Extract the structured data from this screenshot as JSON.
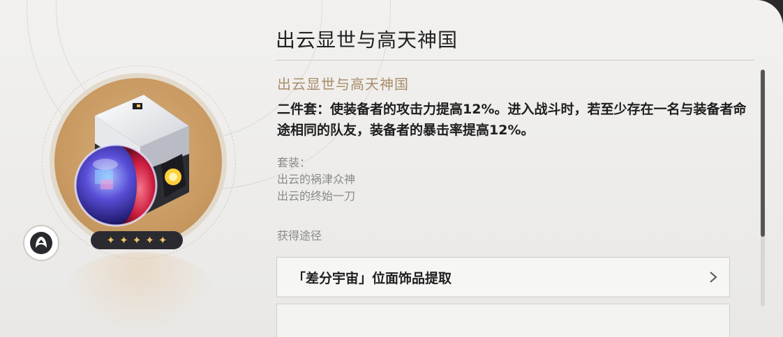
{
  "item": {
    "title": "出云显世与高天神国",
    "set_name": "出云显世与高天神国",
    "effect": "二件套：使装备者的攻击力提高12%。进入战斗时，若至少存在一名与装备者命途相同的队友，装备者的暴击率提高12%。",
    "rarity_stars": 5,
    "rarity_glyph": "✦"
  },
  "set_pieces": {
    "label": "套装：",
    "items": [
      "出云的祸津众神",
      "出云的终始一刀"
    ]
  },
  "acquisition": {
    "label": "获得途径",
    "sources": [
      {
        "label": "「差分宇宙」位面饰品提取"
      }
    ]
  },
  "colors": {
    "accent_gold": "#a88d6a",
    "star": "#f2c46a",
    "relic_disk": "#c99a62"
  },
  "icons": {
    "relic": "relic-planar-ornament-icon",
    "path": "path-emblem-icon",
    "chevron": "chevron-right-icon"
  }
}
